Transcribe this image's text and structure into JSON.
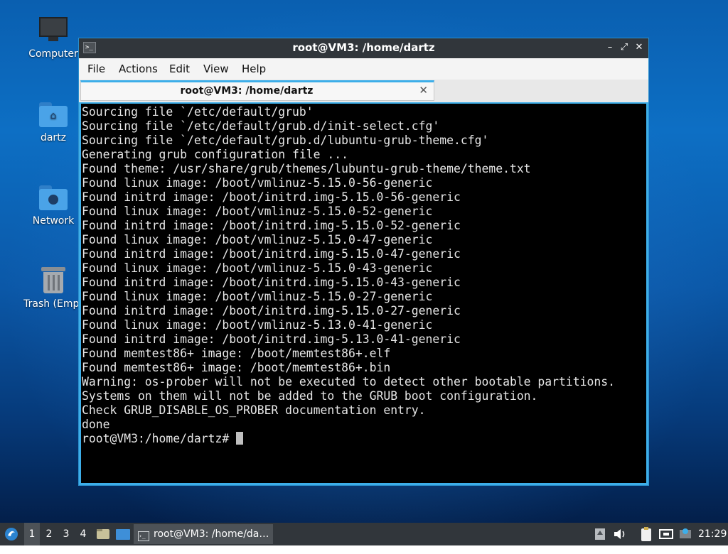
{
  "desktop": {
    "icons": [
      {
        "label": "Computer",
        "icon": "monitor-icon"
      },
      {
        "label": "dartz",
        "icon": "home-folder-icon"
      },
      {
        "label": "Network",
        "icon": "network-folder-icon"
      },
      {
        "label": "Trash (Empt",
        "icon": "trash-icon"
      }
    ]
  },
  "window": {
    "title": "root@VM3: /home/dartz",
    "app_icon_text": ">_",
    "controls": {
      "minimize": "–",
      "maximize": "⤢",
      "close": "✕"
    },
    "menu": [
      "File",
      "Actions",
      "Edit",
      "View",
      "Help"
    ],
    "tab": {
      "label": "root@VM3: /home/dartz",
      "close": "✕"
    },
    "terminal_lines": [
      "Sourcing file `/etc/default/grub'",
      "Sourcing file `/etc/default/grub.d/init-select.cfg'",
      "Sourcing file `/etc/default/grub.d/lubuntu-grub-theme.cfg'",
      "Generating grub configuration file ...",
      "Found theme: /usr/share/grub/themes/lubuntu-grub-theme/theme.txt",
      "Found linux image: /boot/vmlinuz-5.15.0-56-generic",
      "Found initrd image: /boot/initrd.img-5.15.0-56-generic",
      "Found linux image: /boot/vmlinuz-5.15.0-52-generic",
      "Found initrd image: /boot/initrd.img-5.15.0-52-generic",
      "Found linux image: /boot/vmlinuz-5.15.0-47-generic",
      "Found initrd image: /boot/initrd.img-5.15.0-47-generic",
      "Found linux image: /boot/vmlinuz-5.15.0-43-generic",
      "Found initrd image: /boot/initrd.img-5.15.0-43-generic",
      "Found linux image: /boot/vmlinuz-5.15.0-27-generic",
      "Found initrd image: /boot/initrd.img-5.15.0-27-generic",
      "Found linux image: /boot/vmlinuz-5.13.0-41-generic",
      "Found initrd image: /boot/initrd.img-5.13.0-41-generic",
      "Found memtest86+ image: /boot/memtest86+.elf",
      "Found memtest86+ image: /boot/memtest86+.bin",
      "Warning: os-prober will not be executed to detect other bootable partitions.",
      "Systems on them will not be added to the GRUB boot configuration.",
      "Check GRUB_DISABLE_OS_PROBER documentation entry.",
      "done"
    ],
    "prompt": "root@VM3:/home/dartz# "
  },
  "taskbar": {
    "workspaces": [
      "1",
      "2",
      "3",
      "4"
    ],
    "active_workspace": "1",
    "task_label": "root@VM3: /home/da…",
    "clock": "21:29",
    "colors": {
      "accent": "#3daee9",
      "panel": "#31363b"
    }
  }
}
